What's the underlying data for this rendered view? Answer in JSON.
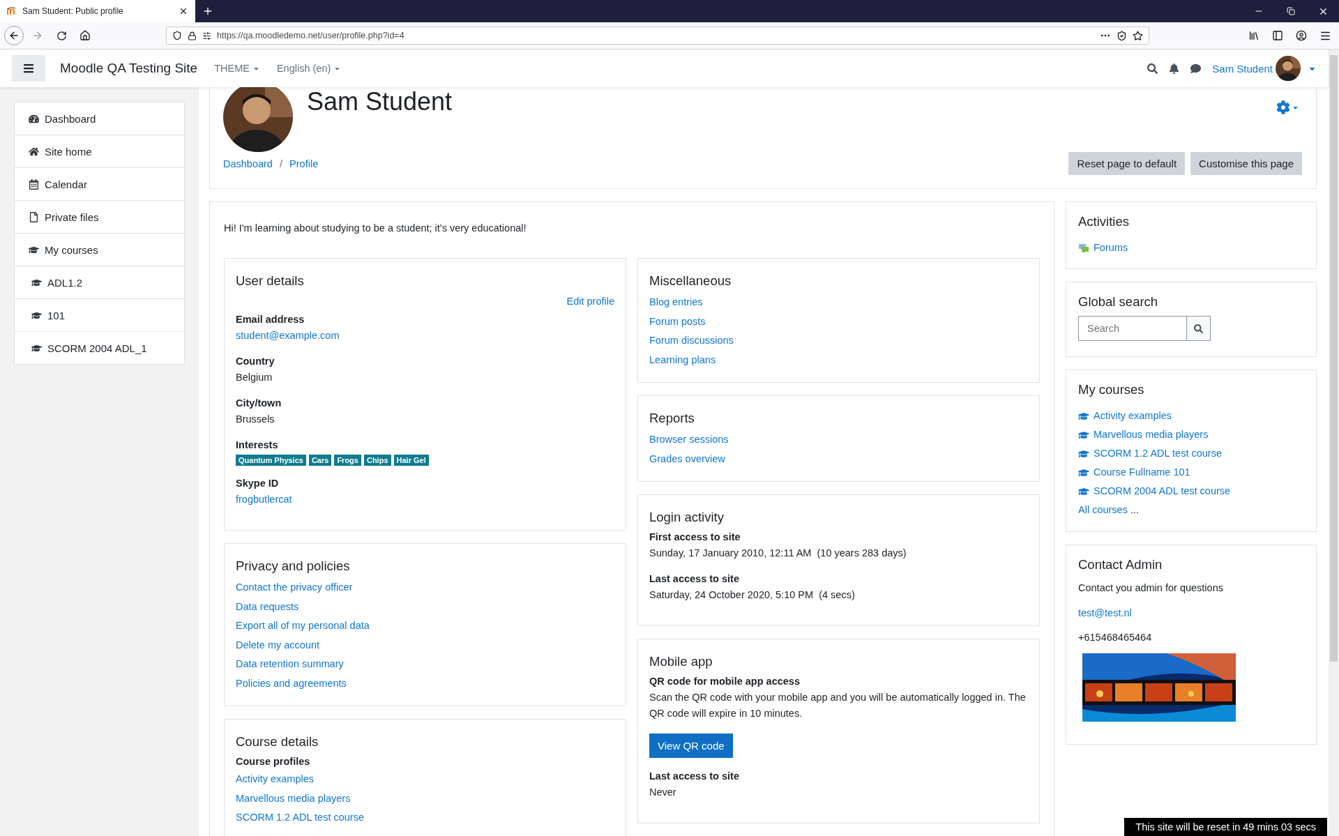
{
  "browser": {
    "tab_title": "Sam Student: Public profile",
    "url": "https://qa.moodledemo.net/user/profile.php?id=4"
  },
  "navbar": {
    "site_name": "Moodle QA Testing Site",
    "menus": [
      "THEME",
      "English (en)"
    ],
    "user_name": "Sam Student"
  },
  "drawer": {
    "items": [
      {
        "label": "Dashboard",
        "kind": "dashboard"
      },
      {
        "label": "Site home",
        "kind": "home"
      },
      {
        "label": "Calendar",
        "kind": "calendar"
      },
      {
        "label": "Private files",
        "kind": "file"
      },
      {
        "label": "My courses",
        "kind": "course",
        "children": [
          {
            "label": "ADL1.2",
            "kind": "course"
          },
          {
            "label": "101",
            "kind": "course"
          },
          {
            "label": "SCORM 2004 ADL_1",
            "kind": "course"
          }
        ]
      }
    ]
  },
  "header": {
    "name": "Sam Student",
    "breadcrumb": [
      "Dashboard",
      "Profile"
    ],
    "separator": "/",
    "buttons": [
      "Reset page to default",
      "Customise this page"
    ]
  },
  "profile": {
    "description": "Hi! I'm learning about studying to be a student; it's very educational!",
    "left_column": [
      {
        "kind": "details",
        "title": "User details",
        "action": "Edit profile",
        "fields": [
          {
            "label": "Email address",
            "kind": "link",
            "value": "student@example.com"
          },
          {
            "label": "Country",
            "kind": "text",
            "value": "Belgium"
          },
          {
            "label": "City/town",
            "kind": "text",
            "value": "Brussels"
          },
          {
            "label": "Interests",
            "kind": "tags",
            "tags": [
              "Quantum Physics",
              "Cars",
              "Frogs",
              "Chips",
              "Hair Gel"
            ]
          },
          {
            "label": "Skype ID",
            "kind": "link",
            "value": "frogbutlercat"
          }
        ]
      },
      {
        "kind": "links",
        "title": "Privacy and policies",
        "links": [
          "Contact the privacy officer",
          "Data requests",
          "Export all of my personal data",
          "Delete my account",
          "Data retention summary",
          "Policies and agreements"
        ]
      },
      {
        "kind": "links",
        "title": "Course details",
        "subtitle": "Course profiles",
        "links": [
          "Activity examples",
          "Marvellous media players",
          "SCORM 1.2 ADL test course"
        ]
      }
    ],
    "right_column": [
      {
        "kind": "links",
        "title": "Miscellaneous",
        "links": [
          "Blog entries",
          "Forum posts",
          "Forum discussions",
          "Learning plans"
        ]
      },
      {
        "kind": "links",
        "title": "Reports",
        "links": [
          "Browser sessions",
          "Grades overview"
        ]
      },
      {
        "kind": "details",
        "title": "Login activity",
        "fields": [
          {
            "label": "First access to site",
            "kind": "text",
            "value": "Sunday, 17 January 2010, 12:11 AM  (10 years 283 days)"
          },
          {
            "label": "Last access to site",
            "kind": "text",
            "value": "Saturday, 24 October 2020, 5:10 PM  (4 secs)"
          }
        ]
      },
      {
        "kind": "mobile",
        "title": "Mobile app",
        "subtitle": "QR code for mobile app access",
        "text": "Scan the QR code with your mobile app and you will be automatically logged in. The QR code will expire in 10 minutes.",
        "button": "View QR code",
        "fields": [
          {
            "label": "Last access to site",
            "kind": "text",
            "value": "Never"
          }
        ]
      }
    ]
  },
  "blocks": [
    {
      "kind": "activities",
      "title": "Activities",
      "links": [
        "Forums"
      ]
    },
    {
      "kind": "search",
      "title": "Global search",
      "placeholder": "Search"
    },
    {
      "kind": "courses",
      "title": "My courses",
      "links": [
        "Activity examples",
        "Marvellous media players",
        "SCORM 1.2 ADL test course",
        "Course Fullname 101",
        "SCORM 2004 ADL test course"
      ],
      "more": "All courses",
      "more_suffix": "..."
    },
    {
      "kind": "contact",
      "title": "Contact Admin",
      "text": "Contact you admin for questions",
      "email": "test@test.nl",
      "phone": "+615468465464"
    }
  ],
  "notice": "This site will be reset in 49 mins 03 secs"
}
